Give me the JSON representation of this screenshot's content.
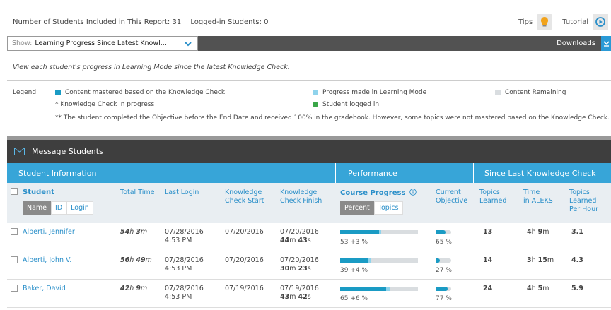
{
  "top": {
    "students_count_text": "Number of Students Included in This Report: 31",
    "logged_in_text": "Logged-in Students: 0",
    "tips_label": "Tips",
    "tutorial_label": "Tutorial"
  },
  "show": {
    "prefix": "Show:",
    "value": "Learning Progress Since Latest Knowl...",
    "downloads_label": "Downloads"
  },
  "description": "View each student's progress in Learning Mode since the latest Knowledge Check.",
  "legend": {
    "label": "Legend:",
    "mastered": "Content mastered based on the Knowledge Check",
    "progress": "Progress made in Learning Mode",
    "remaining": "Content Remaining",
    "in_progress": "*  Knowledge Check in progress",
    "logged_in": "Student logged in",
    "note": "** The student completed the Objective before the End Date and received 100% in the gradebook. However, some topics were not mastered based on the Knowledge Check.",
    "colors": {
      "mastered": "#1a9bc4",
      "progress": "#8fd3ec",
      "remaining": "#d9dde0",
      "logged": "#3aa648"
    }
  },
  "message_students": "Message Students",
  "groups": {
    "student_info": "Student Information",
    "performance": "Performance",
    "since_last": "Since Last Knowledge Check"
  },
  "headers": {
    "student": "Student",
    "name_tab": "Name",
    "id_tab": "ID",
    "login_tab": "Login",
    "total_time": "Total Time",
    "last_login": "Last Login",
    "kc_start_1": "Knowledge",
    "kc_start_2": "Check Start",
    "kc_finish_1": "Knowledge",
    "kc_finish_2": "Check Finish",
    "course_progress": "Course Progress",
    "percent_tab": "Percent",
    "topics_tab": "Topics",
    "current_1": "Current",
    "current_2": "Objective",
    "topics_learned_1": "Topics",
    "topics_learned_2": "Learned",
    "time_in_1": "Time",
    "time_in_2": "in ALEKS",
    "per_hour_1": "Topics",
    "per_hour_2": "Learned",
    "per_hour_3": "Per Hour"
  },
  "rows": [
    {
      "name": "Alberti, Jennifer",
      "total_h": "54",
      "total_m": "3",
      "last_login_date": "07/28/2016",
      "last_login_time": "4:53 PM",
      "kc_start": "07/20/2016",
      "kc_finish_date": "07/20/2016",
      "kc_finish_m": "44",
      "kc_finish_s": "43",
      "course_mastered": 53,
      "course_gain": 3,
      "course_text": "53 +3 %",
      "objective_pct": 65,
      "objective_text": "65 %",
      "topics_learned": "13",
      "time_h": "4",
      "time_m": "9",
      "per_hour": "3.1"
    },
    {
      "name": "Alberti, John V.",
      "total_h": "56",
      "total_m": "49",
      "last_login_date": "07/28/2016",
      "last_login_time": "4:53 PM",
      "kc_start": "07/20/2016",
      "kc_finish_date": "07/20/2016",
      "kc_finish_m": "30",
      "kc_finish_s": "23",
      "course_mastered": 39,
      "course_gain": 4,
      "course_text": "39 +4 %",
      "objective_pct": 27,
      "objective_text": "27 %",
      "topics_learned": "14",
      "time_h": "3",
      "time_m": "15",
      "per_hour": "4.3"
    },
    {
      "name": "Baker, David",
      "total_h": "42",
      "total_m": "9",
      "last_login_date": "07/28/2016",
      "last_login_time": "4:53 PM",
      "kc_start": "07/19/2016",
      "kc_finish_date": "07/19/2016",
      "kc_finish_m": "43",
      "kc_finish_s": "42",
      "course_mastered": 65,
      "course_gain": 6,
      "course_text": "65 +6 %",
      "objective_pct": 77,
      "objective_text": "77 %",
      "topics_learned": "24",
      "time_h": "4",
      "time_m": "5",
      "per_hour": "5.9"
    }
  ]
}
